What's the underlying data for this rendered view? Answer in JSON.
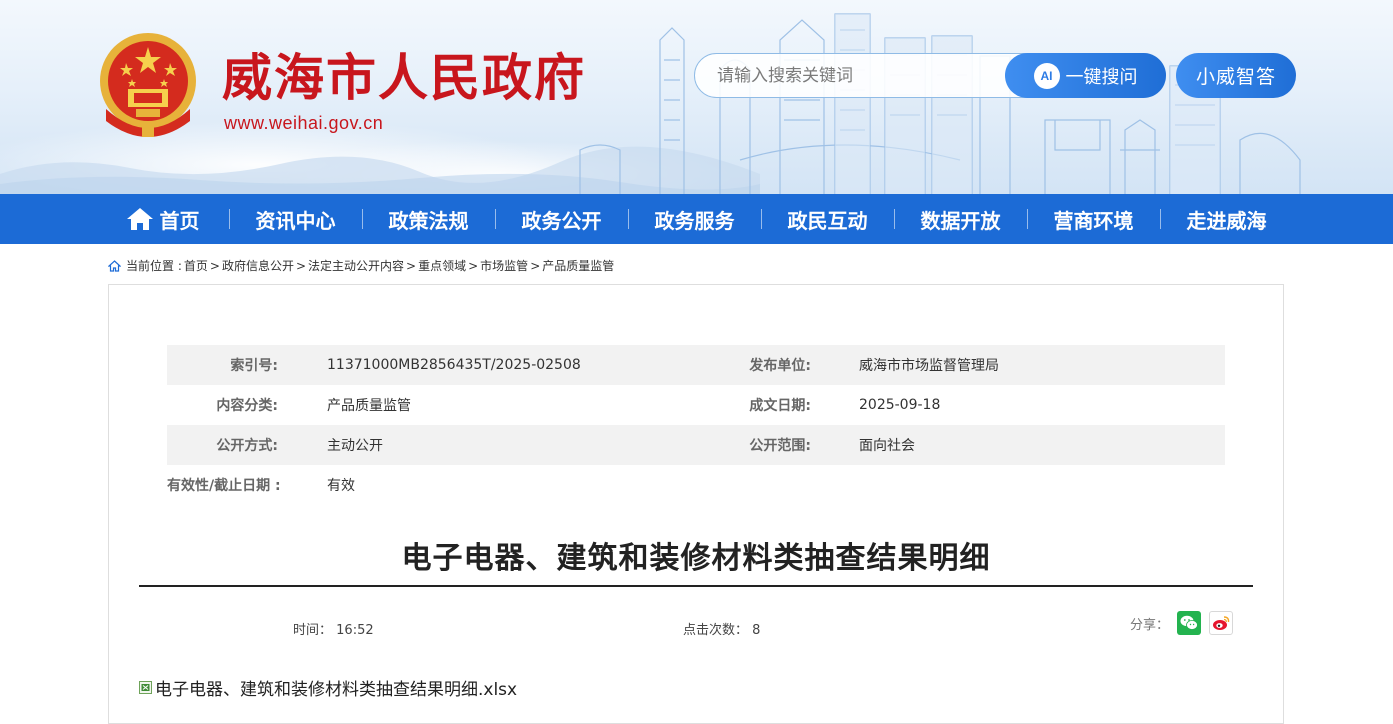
{
  "site": {
    "title": "威海市人民政府",
    "url": "www.weihai.gov.cn"
  },
  "search": {
    "placeholder": "请输入搜索关键词",
    "button_label": "一键搜问",
    "ai_badge": "AI",
    "assistant_label": "小威智答"
  },
  "nav": {
    "items": [
      {
        "label": "首页"
      },
      {
        "label": "资讯中心"
      },
      {
        "label": "政策法规"
      },
      {
        "label": "政务公开"
      },
      {
        "label": "政务服务"
      },
      {
        "label": "政民互动"
      },
      {
        "label": "数据开放"
      },
      {
        "label": "营商环境"
      },
      {
        "label": "走进威海"
      }
    ]
  },
  "breadcrumb": {
    "prefix": "当前位置 :",
    "items": [
      "首页",
      "政府信息公开",
      "法定主动公开内容",
      "重点领域",
      "市场监管",
      "产品质量监管"
    ],
    "separator": ">"
  },
  "meta": {
    "index_label": "索引号:",
    "index_value": "11371000MB2856435T/2025-02508",
    "publisher_label": "发布单位:",
    "publisher_value": "威海市市场监督管理局",
    "category_label": "内容分类:",
    "category_value": "产品质量监管",
    "date_label": "成文日期:",
    "date_value": "2025-09-18",
    "method_label": "公开方式:",
    "method_value": "主动公开",
    "scope_label": "公开范围:",
    "scope_value": "面向社会",
    "validity_label": "有效性/截止日期 :",
    "validity_value": "有效"
  },
  "article": {
    "title": "电子电器、建筑和装修材料类抽查结果明细",
    "time_label": "时间：",
    "time_value": "16:52",
    "clicks_label": "点击次数：",
    "clicks_value": "8",
    "share_label": "分享：",
    "attachment_name": "电子电器、建筑和装修材料类抽查结果明细.xlsx"
  },
  "colors": {
    "brand_red": "#c8161d",
    "nav_blue": "#1c6bd6",
    "button_blue": "#2c7be5"
  }
}
